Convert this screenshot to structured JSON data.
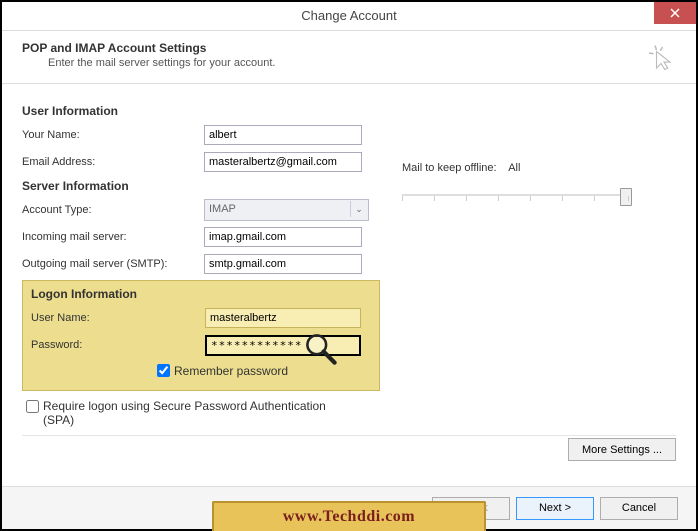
{
  "title": "Change Account",
  "header": {
    "title": "POP and IMAP Account Settings",
    "subtitle": "Enter the mail server settings for your account."
  },
  "sections": {
    "user_info": "User Information",
    "server_info": "Server Information",
    "logon_info": "Logon Information"
  },
  "labels": {
    "your_name": "Your Name:",
    "email": "Email Address:",
    "account_type": "Account Type:",
    "incoming": "Incoming mail server:",
    "outgoing": "Outgoing mail server (SMTP):",
    "username": "User Name:",
    "password": "Password:",
    "remember": "Remember password",
    "spa": "Require logon using Secure Password Authentication (SPA)",
    "mail_offline": "Mail to keep offline:",
    "mail_offline_val": "All"
  },
  "values": {
    "your_name": "albert",
    "email": "masteralbertz@gmail.com",
    "account_type": "IMAP",
    "incoming": "imap.gmail.com",
    "outgoing": "smtp.gmail.com",
    "username": "masteralbertz",
    "password": "************"
  },
  "buttons": {
    "more": "More Settings ...",
    "back": "< Back",
    "next": "Next >",
    "cancel": "Cancel"
  },
  "watermark": "www.Techddi.com"
}
